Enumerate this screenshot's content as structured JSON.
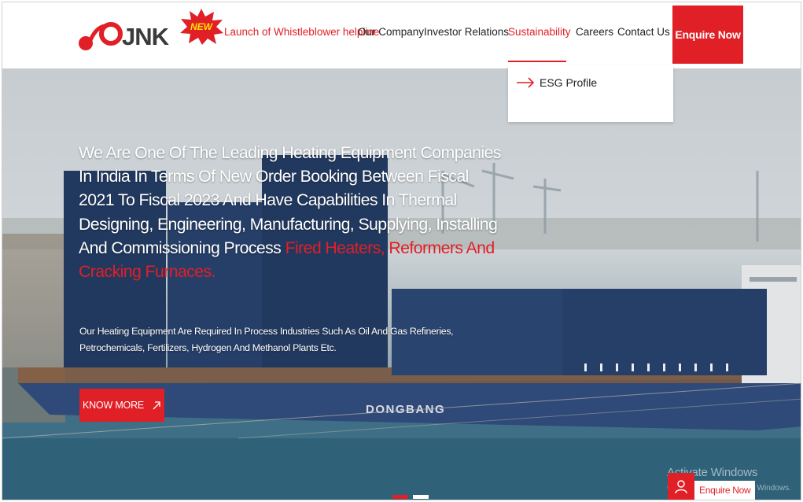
{
  "header": {
    "logo_text": "JNK",
    "new_badge": "NEW",
    "nav": {
      "whistleblower": "Launch of Whistleblower helpline",
      "our_company": "Our Company",
      "investor_relations": "Investor Relations",
      "sustainability": "Sustainability",
      "careers": "Careers",
      "contact_us": "Contact Us"
    },
    "enquire": "Enquire Now"
  },
  "dropdown": {
    "items": [
      {
        "label": "ESG Profile"
      }
    ]
  },
  "hero": {
    "headline_white": "We Are One Of The Leading Heating Equipment Companies In India In Terms Of New Order Booking Between Fiscal 2021 To Fiscal 2023 And Have Capabilities In Thermal Designing, Engineering, Manufacturing, Supplying, Installing And Commissioning Process",
    "headline_red": "Fired Heaters, Reformers And Cracking Furnaces.",
    "subtext": "Our Heating Equipment Are Required In Process Industries Such As Oil And Gas Refineries, Petrochemicals, Fertilizers, Hydrogen And Methanol Plants Etc.",
    "cta": "KNOW MORE",
    "ship_name": "DONGBANG",
    "slides": {
      "count": 2,
      "active": 1
    }
  },
  "floating": {
    "enquire": "Enquire Now"
  },
  "watermark": {
    "title": "Activate Windows",
    "subtitle": "Go to Settings to activate Windows."
  },
  "colors": {
    "brand_red": "#e11f26",
    "text_dark": "#222222"
  }
}
